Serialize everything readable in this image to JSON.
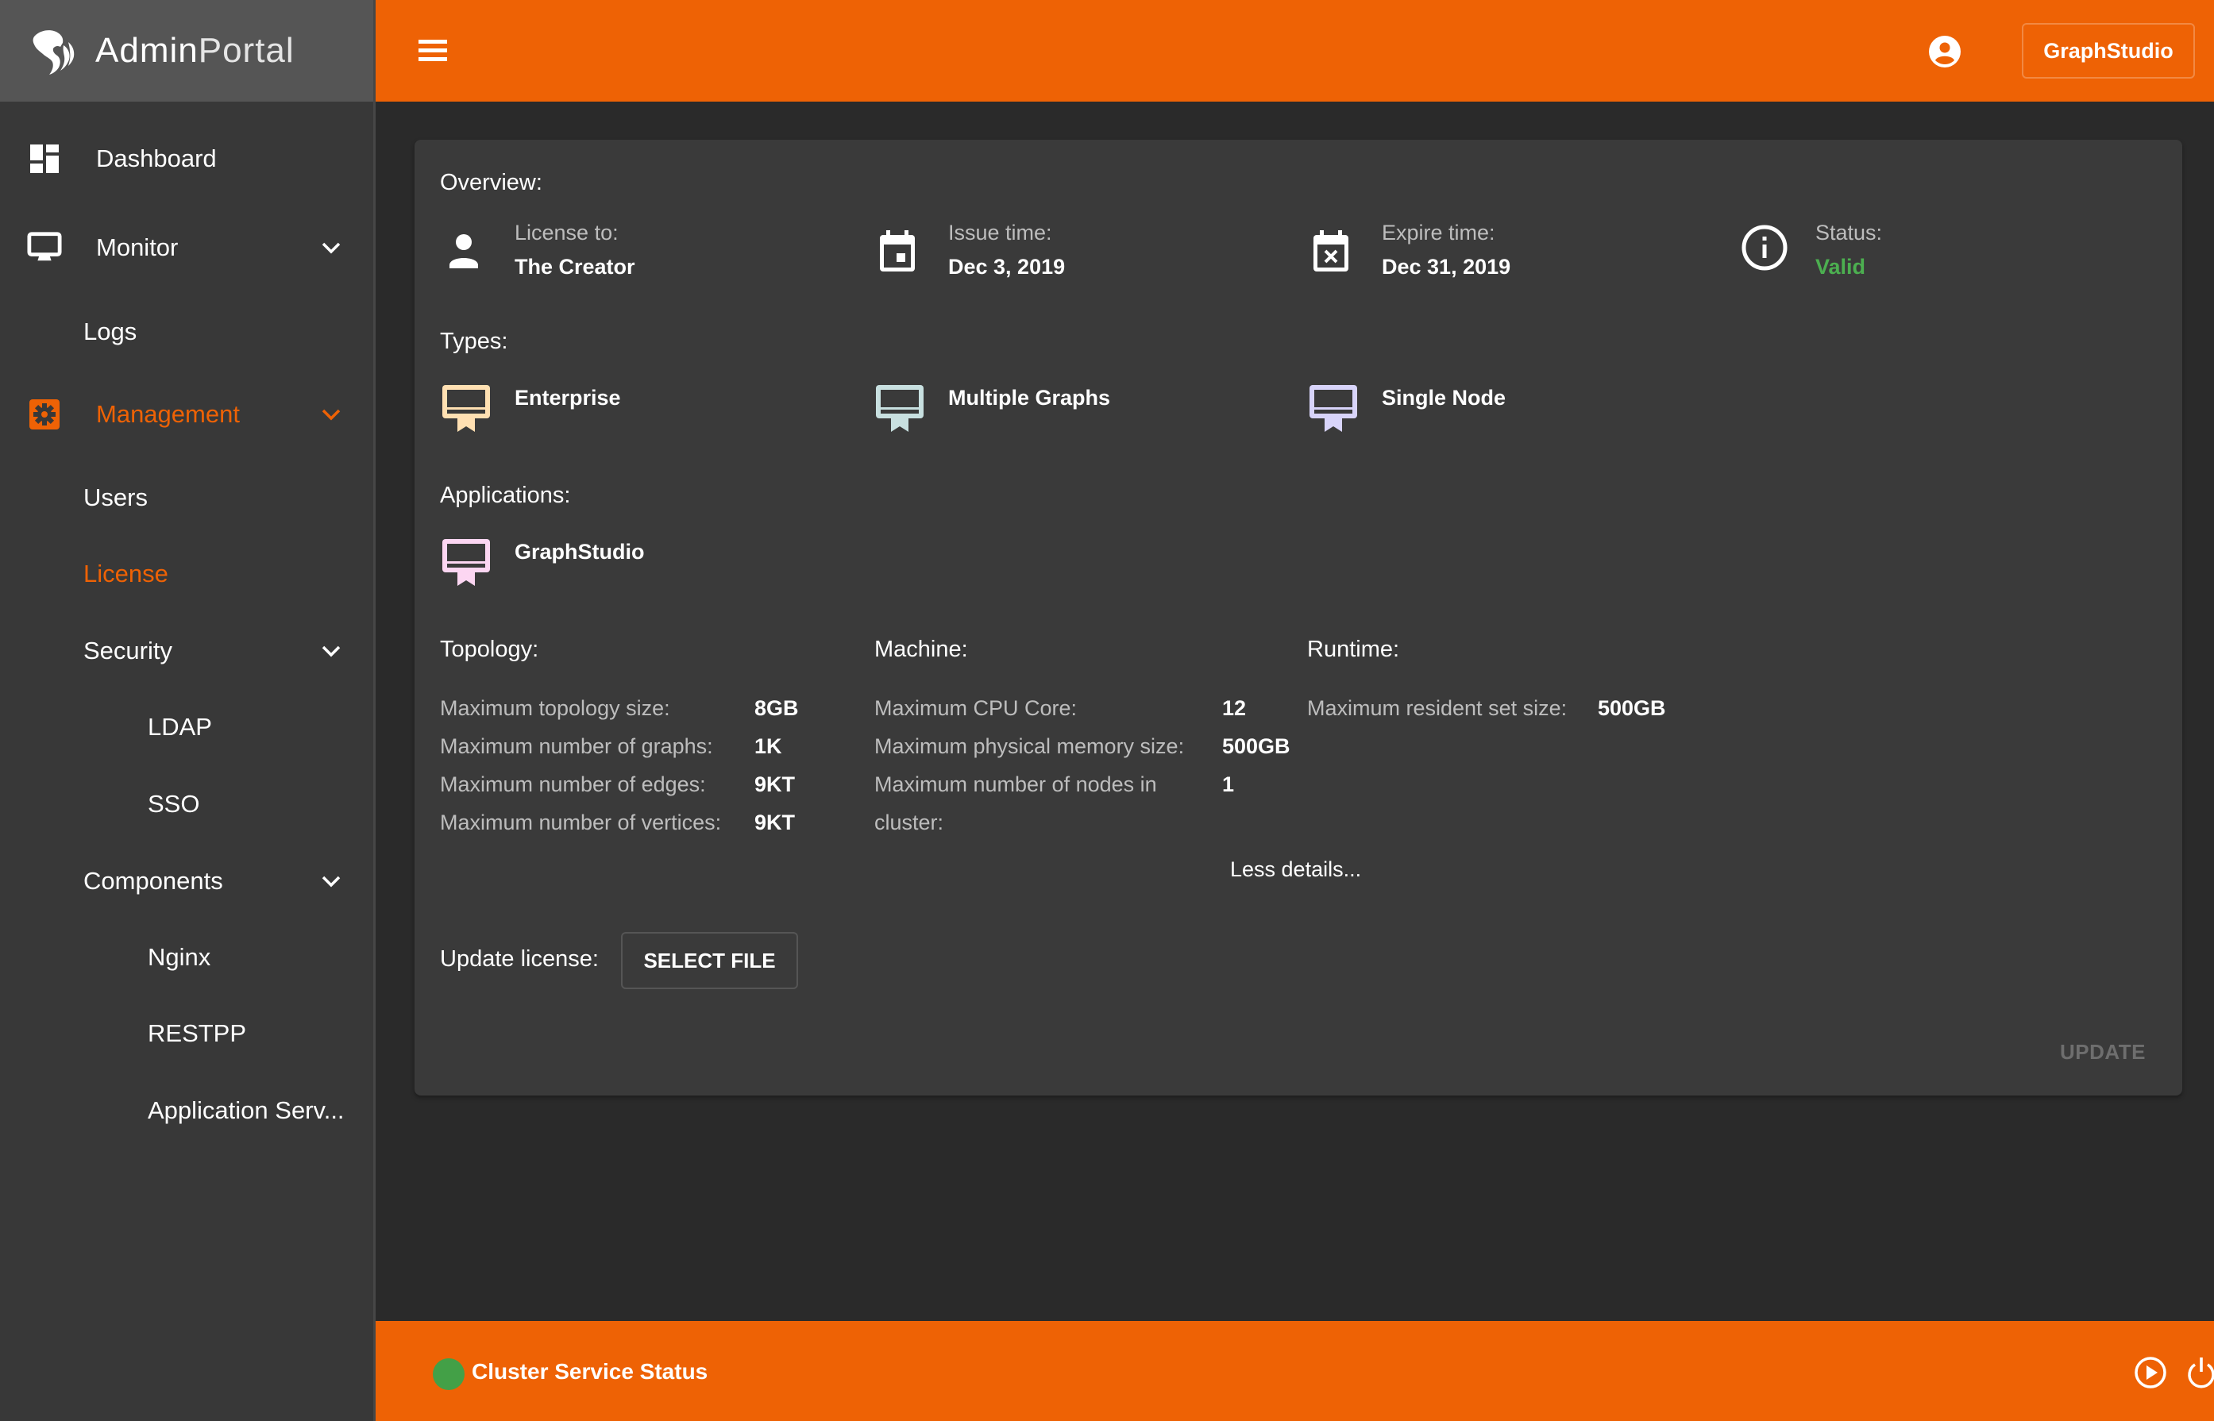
{
  "app": {
    "brand_strong": "Admin",
    "brand_light": "Portal"
  },
  "colors": {
    "accent": "#ee6205",
    "sidebar_bg": "#383838",
    "brand_bg": "#555555",
    "content_bg": "#2a2a2a",
    "card_bg": "#3a3a3a",
    "valid_green": "#4caf50",
    "status_dot": "#43a047",
    "type_enterprise": "#ffe0b2",
    "type_multiple_graphs": "#c8e0e0",
    "type_single_node": "#d8d4fa",
    "app_graphstudio": "#fcd6f2"
  },
  "topbar": {
    "menu_icon": "hamburger-icon",
    "user_icon": "account-circle-icon",
    "graphstudio_button": "GraphStudio"
  },
  "sidebar": {
    "items": [
      {
        "label": "Dashboard",
        "icon": "dashboard-icon",
        "level": 0,
        "expandable": false,
        "active": false
      },
      {
        "label": "Monitor",
        "icon": "monitor-icon",
        "level": 0,
        "expandable": true,
        "active": false
      },
      {
        "label": "Logs",
        "level": 1,
        "expandable": false,
        "active": false
      },
      {
        "label": "Management",
        "icon": "settings-box-icon",
        "level": 0,
        "expandable": true,
        "active": true
      },
      {
        "label": "Users",
        "level": 1,
        "expandable": false,
        "active": false
      },
      {
        "label": "License",
        "level": 1,
        "expandable": false,
        "active": true
      },
      {
        "label": "Security",
        "level": 1,
        "expandable": true,
        "active": false
      },
      {
        "label": "LDAP",
        "level": 2,
        "expandable": false,
        "active": false
      },
      {
        "label": "SSO",
        "level": 2,
        "expandable": false,
        "active": false
      },
      {
        "label": "Components",
        "level": 1,
        "expandable": true,
        "active": false
      },
      {
        "label": "Nginx",
        "level": 2,
        "expandable": false,
        "active": false
      },
      {
        "label": "RESTPP",
        "level": 2,
        "expandable": false,
        "active": false
      },
      {
        "label": "Application Serv...",
        "level": 2,
        "expandable": false,
        "active": false
      }
    ]
  },
  "license": {
    "overview_title": "Overview:",
    "overview": [
      {
        "label": "License to:",
        "value": "The Creator",
        "icon": "person-icon"
      },
      {
        "label": "Issue time:",
        "value": "Dec 3, 2019",
        "icon": "calendar-today-icon"
      },
      {
        "label": "Expire time:",
        "value": "Dec 31, 2019",
        "icon": "calendar-remove-icon"
      },
      {
        "label": "Status:",
        "value": "Valid",
        "icon": "info-icon"
      }
    ],
    "types_title": "Types:",
    "types": [
      {
        "label": "Enterprise",
        "icon": "certificate-icon"
      },
      {
        "label": "Multiple Graphs",
        "icon": "certificate-icon"
      },
      {
        "label": "Single Node",
        "icon": "certificate-icon"
      }
    ],
    "applications_title": "Applications:",
    "applications": [
      {
        "label": "GraphStudio",
        "icon": "certificate-icon"
      }
    ],
    "topology": {
      "title": "Topology:",
      "rows": [
        {
          "label": "Maximum topology size:",
          "value": "8GB"
        },
        {
          "label": "Maximum number of graphs:",
          "value": "1K"
        },
        {
          "label": "Maximum number of edges:",
          "value": "9KT"
        },
        {
          "label": "Maximum number of vertices:",
          "value": "9KT"
        }
      ]
    },
    "machine": {
      "title": "Machine:",
      "rows": [
        {
          "label": "Maximum CPU Core:",
          "value": "12"
        },
        {
          "label": "Maximum physical memory size:",
          "value": "500GB"
        },
        {
          "label": "Maximum number of nodes in",
          "label_line2": "cluster:",
          "value": "1"
        }
      ]
    },
    "runtime": {
      "title": "Runtime:",
      "rows": [
        {
          "label": "Maximum resident set size:",
          "value": "500GB"
        }
      ]
    },
    "less_details": "Less details...",
    "update_license_label": "Update license:",
    "select_file_button": "SELECT FILE",
    "update_button": "UPDATE",
    "update_button_disabled": true
  },
  "footer": {
    "status_label": "Cluster Service Status",
    "status_state": "healthy",
    "start_icon": "play-circle-icon",
    "power_icon": "power-icon"
  }
}
